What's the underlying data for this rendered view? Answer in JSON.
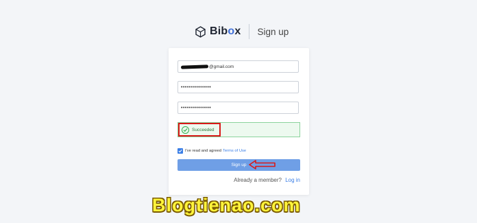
{
  "header": {
    "logo_prefix": "Bib",
    "logo_o": "o",
    "logo_suffix": "x",
    "title": "Sign up"
  },
  "form": {
    "email_value": "@gmail.com",
    "password_value": "•••••••••••••••",
    "confirm_password_value": "•••••••••••••••",
    "captcha_status": "Succeeded",
    "agree_text": "I've read and agreed",
    "terms_link": "Terms of Use",
    "agree_checked": true,
    "signup_button": "Sign up",
    "member_prompt": "Already a member?",
    "login_link": "Log in"
  },
  "watermark": "Blogtienao.com",
  "colors": {
    "accent": "#3a7ee6",
    "success": "#35b250",
    "highlight": "#d91818"
  }
}
